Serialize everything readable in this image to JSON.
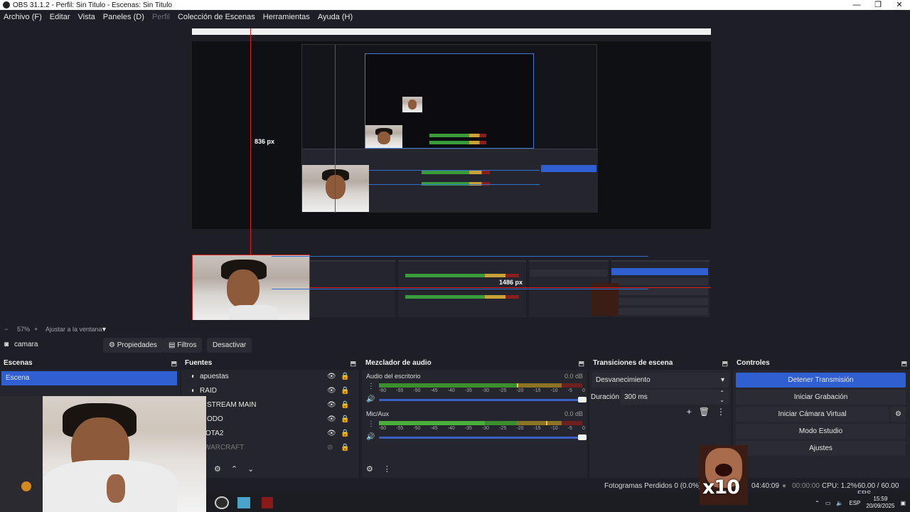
{
  "window": {
    "title": "OBS 31.1.2 - Perfil: Sin Titulo - Escenas: Sin Titulo",
    "controls": [
      "—",
      "❐",
      "✕"
    ]
  },
  "menu": {
    "items": [
      "Archivo (F)",
      "Editar",
      "Vista",
      "Paneles (D)"
    ],
    "disabled_item": "Perfil",
    "items_after": [
      "Colección de Escenas",
      "Herramientas",
      "Ayuda (H)"
    ]
  },
  "preview": {
    "measure_vertical": "836 px",
    "measure_horizontal": "1486 px"
  },
  "zoom": {
    "minus": "−",
    "level": "57%",
    "plus": "+",
    "fit": "Ajustar a la ventana",
    "dropdown_arrow": "▼"
  },
  "source_toolbar": {
    "selected_source": "camara",
    "properties": "Propiedades",
    "filters": "Filtros",
    "deactivate": "Desactivar"
  },
  "scenes": {
    "title": "Escenas",
    "items": [
      "Escena"
    ]
  },
  "sources": {
    "title": "Fuentes",
    "items": [
      "apuestas",
      "RAID",
      "STREAM MAIN",
      "ODO",
      "OTA2",
      "WARCRAFT"
    ]
  },
  "mixer": {
    "title": "Mezclador de audio",
    "tracks": [
      {
        "name": "Audio del escritorio",
        "db": "0.0 dB",
        "level": 0.68
      },
      {
        "name": "Mic/Aux",
        "db": "0.0 dB",
        "level": 0.52
      }
    ],
    "scale": [
      "-60",
      "-55",
      "-50",
      "-45",
      "-40",
      "-35",
      "-30",
      "-25",
      "-20",
      "-15",
      "-10",
      "-5",
      "0"
    ]
  },
  "transitions": {
    "title": "Transiciones de escena",
    "selected": "Desvanecimiento",
    "duration_label": "Duración",
    "duration_value": "300 ms"
  },
  "controls": {
    "title": "Controles",
    "stop_stream": "Detener Transmisión",
    "start_record": "Iniciar Grabación",
    "start_virtualcam": "Iniciar Cámara Virtual",
    "studio_mode": "Modo Estudio",
    "settings": "Ajustes"
  },
  "status": {
    "dropped_frames": "Fotogramas Perdidos 0 (0.0%)",
    "stream_time": "04:40:09",
    "record_time": "00:00:00",
    "cpu": "CPU: 1.2%",
    "fps": "60.00 / 60.00 FPS"
  },
  "taskbar": {
    "language": "ESP",
    "time": "15:59",
    "date": "20/09/2025"
  },
  "overlay": {
    "x10_label": "x10"
  },
  "colors": {
    "accent": "#2f5fd0",
    "bg": "#1e1f26",
    "panel": "#25262d",
    "guide": "#e01d1d"
  }
}
